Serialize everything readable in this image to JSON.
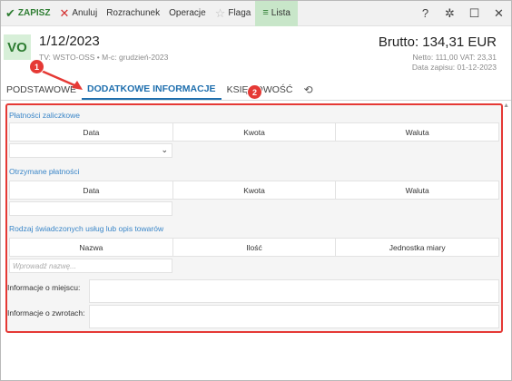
{
  "toolbar": {
    "save_label": "ZAPISZ",
    "cancel_label": "Anuluj",
    "invoice_label": "Rozrachunek",
    "operations_label": "Operacje",
    "flag_label": "Flaga",
    "list_label": "Lista",
    "icons": [
      "check-icon",
      "close-icon",
      "star-icon",
      "list-icon",
      "help-icon",
      "gear-icon",
      "maximize-icon",
      "close-window-icon"
    ]
  },
  "header": {
    "badge": "VO",
    "doc_number": "1/12/2023",
    "meta": "TV: WSTO-OSS  •  M-c: grudzień-2023",
    "gross": "Brutto: 134,31 EUR",
    "net": "Netto: 111,00 VAT: 23,31",
    "saved": "Data zapisu: 01-12-2023"
  },
  "tabs": [
    {
      "label": "PODSTAWOWE",
      "active": false
    },
    {
      "label": "DODATKOWE INFORMACJE",
      "active": true
    },
    {
      "label": "KSIĘGOWOŚĆ",
      "active": false
    }
  ],
  "annotations": {
    "first": "1",
    "second": "2",
    "color": "#e53935"
  },
  "sections": {
    "advance": {
      "title": "Płatności zaliczkowe",
      "columns": [
        "Data",
        "Kwota",
        "Waluta"
      ]
    },
    "received": {
      "title": "Otrzymane płatności",
      "columns": [
        "Data",
        "Kwota",
        "Waluta"
      ]
    },
    "services": {
      "title": "Rodzaj świadczonych usług lub opis towarów",
      "columns": [
        "Nazwa",
        "Ilość",
        "Jednostka miary"
      ],
      "name_placeholder": "Wprowadź nazwę..."
    }
  },
  "fields": {
    "place_label": "Informacje o miejscu:",
    "returns_label": "Informacje o zwrotach:"
  },
  "colors": {
    "accent": "#1f6fae",
    "brand_green": "#2e7d32",
    "section_title": "#3a86c8",
    "highlight": "#e53935"
  }
}
